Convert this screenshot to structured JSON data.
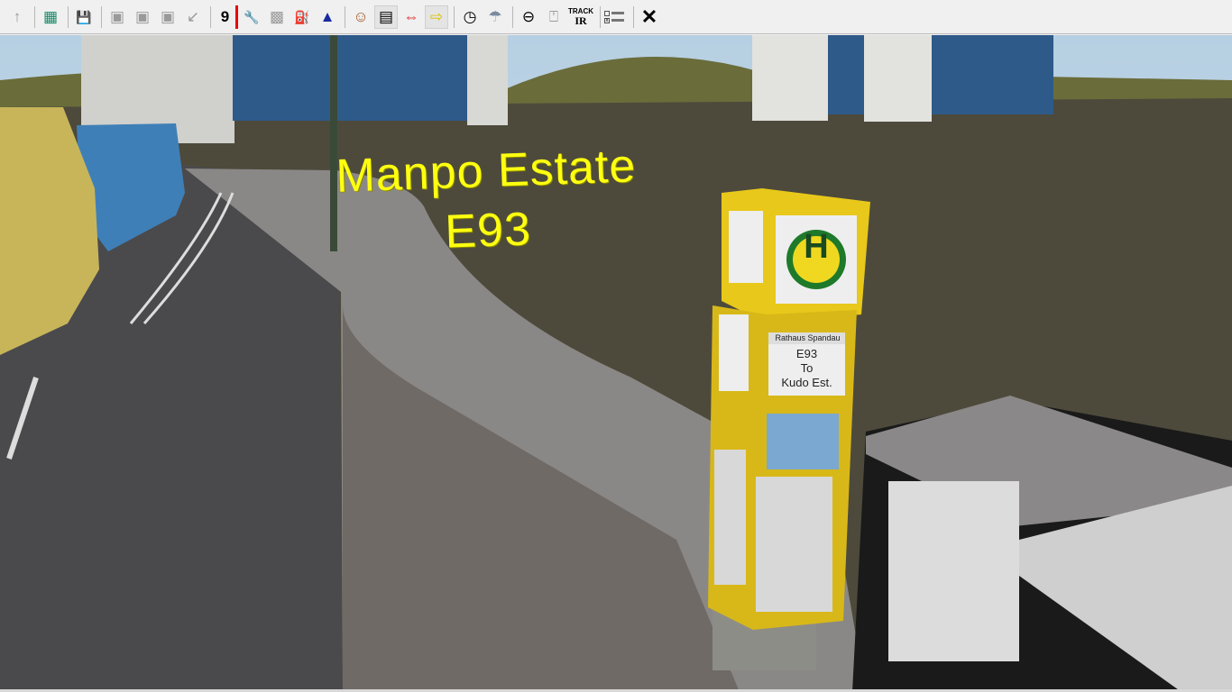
{
  "toolbar": {
    "buttons": [
      {
        "name": "up-arrow-icon",
        "glyph": "↑",
        "enabled": false
      },
      {
        "name": "map-icon",
        "glyph": "▦",
        "enabled": true
      },
      {
        "name": "save-icon",
        "glyph": "💾",
        "enabled": true
      },
      {
        "name": "new-bus-icon",
        "glyph": "▣",
        "enabled": false
      },
      {
        "name": "resize-bus-icon",
        "glyph": "▣",
        "enabled": false
      },
      {
        "name": "bus-frame-icon",
        "glyph": "▣",
        "enabled": false
      },
      {
        "name": "pointer-icon",
        "glyph": "↙",
        "enabled": false
      },
      {
        "name": "line-number-icon",
        "glyph": "9",
        "enabled": true
      },
      {
        "name": "wrench-icon",
        "glyph": "🔧",
        "enabled": true
      },
      {
        "name": "chip-icon",
        "glyph": "▩",
        "enabled": false
      },
      {
        "name": "fuel-icon",
        "glyph": "⛽",
        "enabled": false
      },
      {
        "name": "cap-icon",
        "glyph": "▲",
        "enabled": true
      },
      {
        "name": "driver-icon",
        "glyph": "☺",
        "enabled": true
      },
      {
        "name": "timetable-icon",
        "glyph": "▤",
        "enabled": true
      },
      {
        "name": "pc-driver-switch-icon",
        "glyph": "⇔",
        "enabled": true
      },
      {
        "name": "help-arrow-icon",
        "glyph": "⇨",
        "enabled": true
      },
      {
        "name": "clock-icon",
        "glyph": "◷",
        "enabled": true
      },
      {
        "name": "weather-icon",
        "glyph": "☂",
        "enabled": true
      },
      {
        "name": "steering-icon",
        "glyph": "⊖",
        "enabled": true
      },
      {
        "name": "mouse-icon",
        "glyph": "⍞",
        "enabled": true
      }
    ],
    "trackir_top": "TRACK",
    "trackir_bottom": "IR",
    "close_glyph": "✕"
  },
  "scene": {
    "overlay_title": "Manpo Estate",
    "overlay_route": "E93",
    "stop_sign": {
      "station": "Rathaus Spandau",
      "route": "E93",
      "to": "To",
      "destination": "Kudo Est.",
      "h_symbol": "H"
    },
    "colors": {
      "overlay": "#ffff10",
      "sign_yellow": "#e8c81a",
      "grass": "#4a4a3a",
      "sky": "#c8dcea"
    }
  }
}
